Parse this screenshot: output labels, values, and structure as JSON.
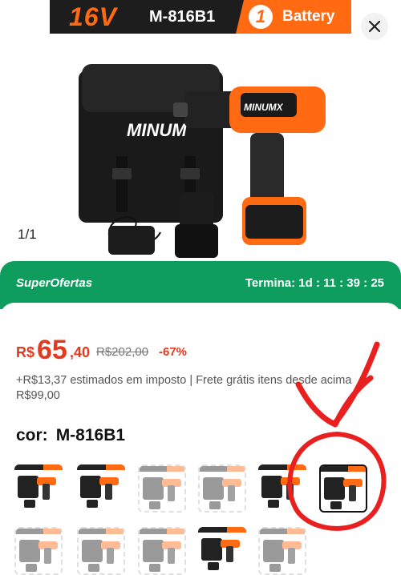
{
  "banner": {
    "voltage": "16V",
    "model": "M-816B1",
    "battery_count": "1",
    "battery_label": "Battery"
  },
  "image_counter": "1/1",
  "promo": {
    "label": "SuperOfertas",
    "countdown": "Termina: 1d : 11 : 39 : 25"
  },
  "price": {
    "currency": "R$",
    "integer": "65",
    "decimal": ",40",
    "original": "R$202,00",
    "discount": "-67%"
  },
  "tax_note": "+R$13,37 estimados em imposto | Frete grátis itens desde acima R$99,00",
  "color": {
    "label": "cor:",
    "value": "M-816B1"
  },
  "colors": {
    "accent": "#ff6a13",
    "promo_green": "#0e9c5f",
    "price_red": "#e23a1e",
    "annotation_red": "#e8201f"
  },
  "icons": {
    "close": "close-icon"
  }
}
